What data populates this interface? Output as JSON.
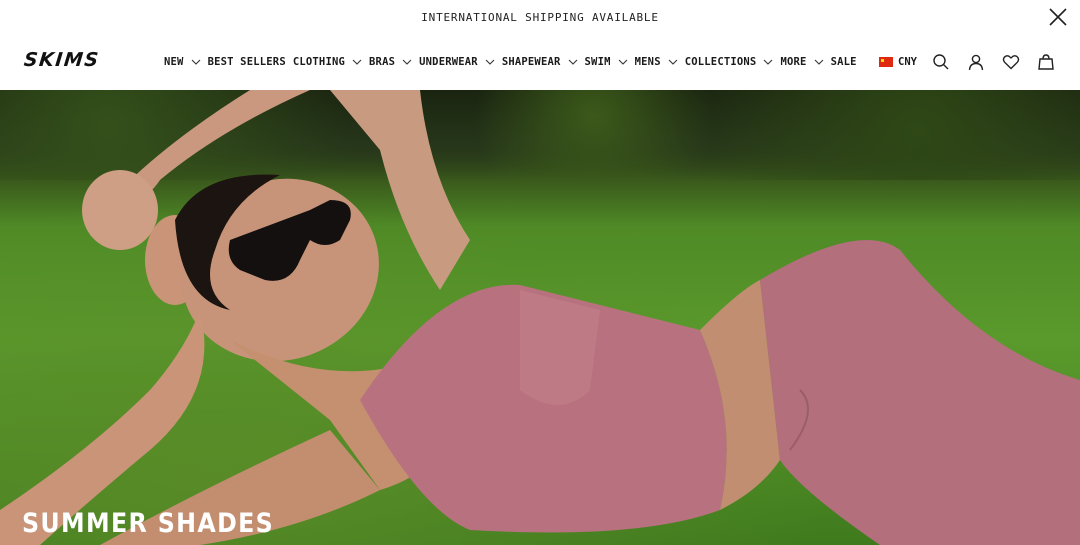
{
  "announcement": {
    "text": "INTERNATIONAL SHIPPING AVAILABLE"
  },
  "header": {
    "logo": "SKIMS",
    "menu": [
      {
        "label": "NEW",
        "has_dropdown": true
      },
      {
        "label": "BEST SELLERS",
        "has_dropdown": false
      },
      {
        "label": "CLOTHING",
        "has_dropdown": true
      },
      {
        "label": "BRAS",
        "has_dropdown": true
      },
      {
        "label": "UNDERWEAR",
        "has_dropdown": true
      },
      {
        "label": "SHAPEWEAR",
        "has_dropdown": true
      },
      {
        "label": "SWIM",
        "has_dropdown": true
      },
      {
        "label": "MENS",
        "has_dropdown": true
      },
      {
        "label": "COLLECTIONS",
        "has_dropdown": true
      },
      {
        "label": "MORE",
        "has_dropdown": true
      },
      {
        "label": "SALE",
        "has_dropdown": false
      }
    ],
    "currency": "CNY",
    "icons": [
      "china-flag-icon",
      "search-icon",
      "account-icon",
      "heart-icon",
      "bag-icon",
      "close-icon",
      "chevron-down-icon"
    ]
  },
  "hero": {
    "title": "SUMMER SHADES"
  },
  "colors": {
    "text": "#1a1a1a",
    "background": "#ffffff",
    "grass": "#5a9a2c",
    "outfit": "#b8727f",
    "hero_title": "#ffffff"
  }
}
